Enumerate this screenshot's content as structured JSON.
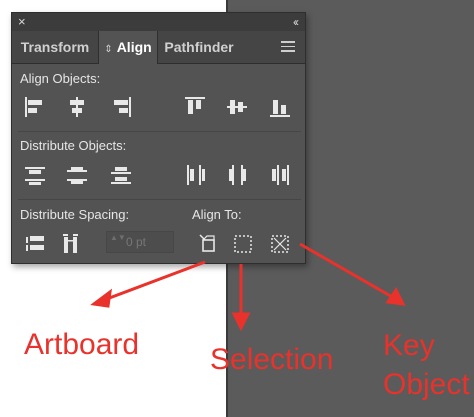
{
  "titlebar": {
    "close_glyph": "×",
    "collapse_glyph": "‹‹"
  },
  "tabs": [
    {
      "label": "Transform",
      "active": false
    },
    {
      "label": "Align",
      "active": true
    },
    {
      "label": "Pathfinder",
      "active": false
    }
  ],
  "align_tab_arrows": "⇕",
  "sections": {
    "align_objects": "Align Objects:",
    "distribute_objects": "Distribute Objects:",
    "distribute_spacing": "Distribute Spacing:",
    "align_to": "Align To:"
  },
  "spacing_field": {
    "value": "0 pt",
    "arrows": "▲▼"
  },
  "annotations": {
    "artboard": "Artboard",
    "selection": "Selection",
    "key_line1": "Key",
    "key_line2": "Object"
  },
  "colors": {
    "panel": "#535353",
    "annotation": "#e8322b",
    "artboard": "#5b5b5b"
  }
}
